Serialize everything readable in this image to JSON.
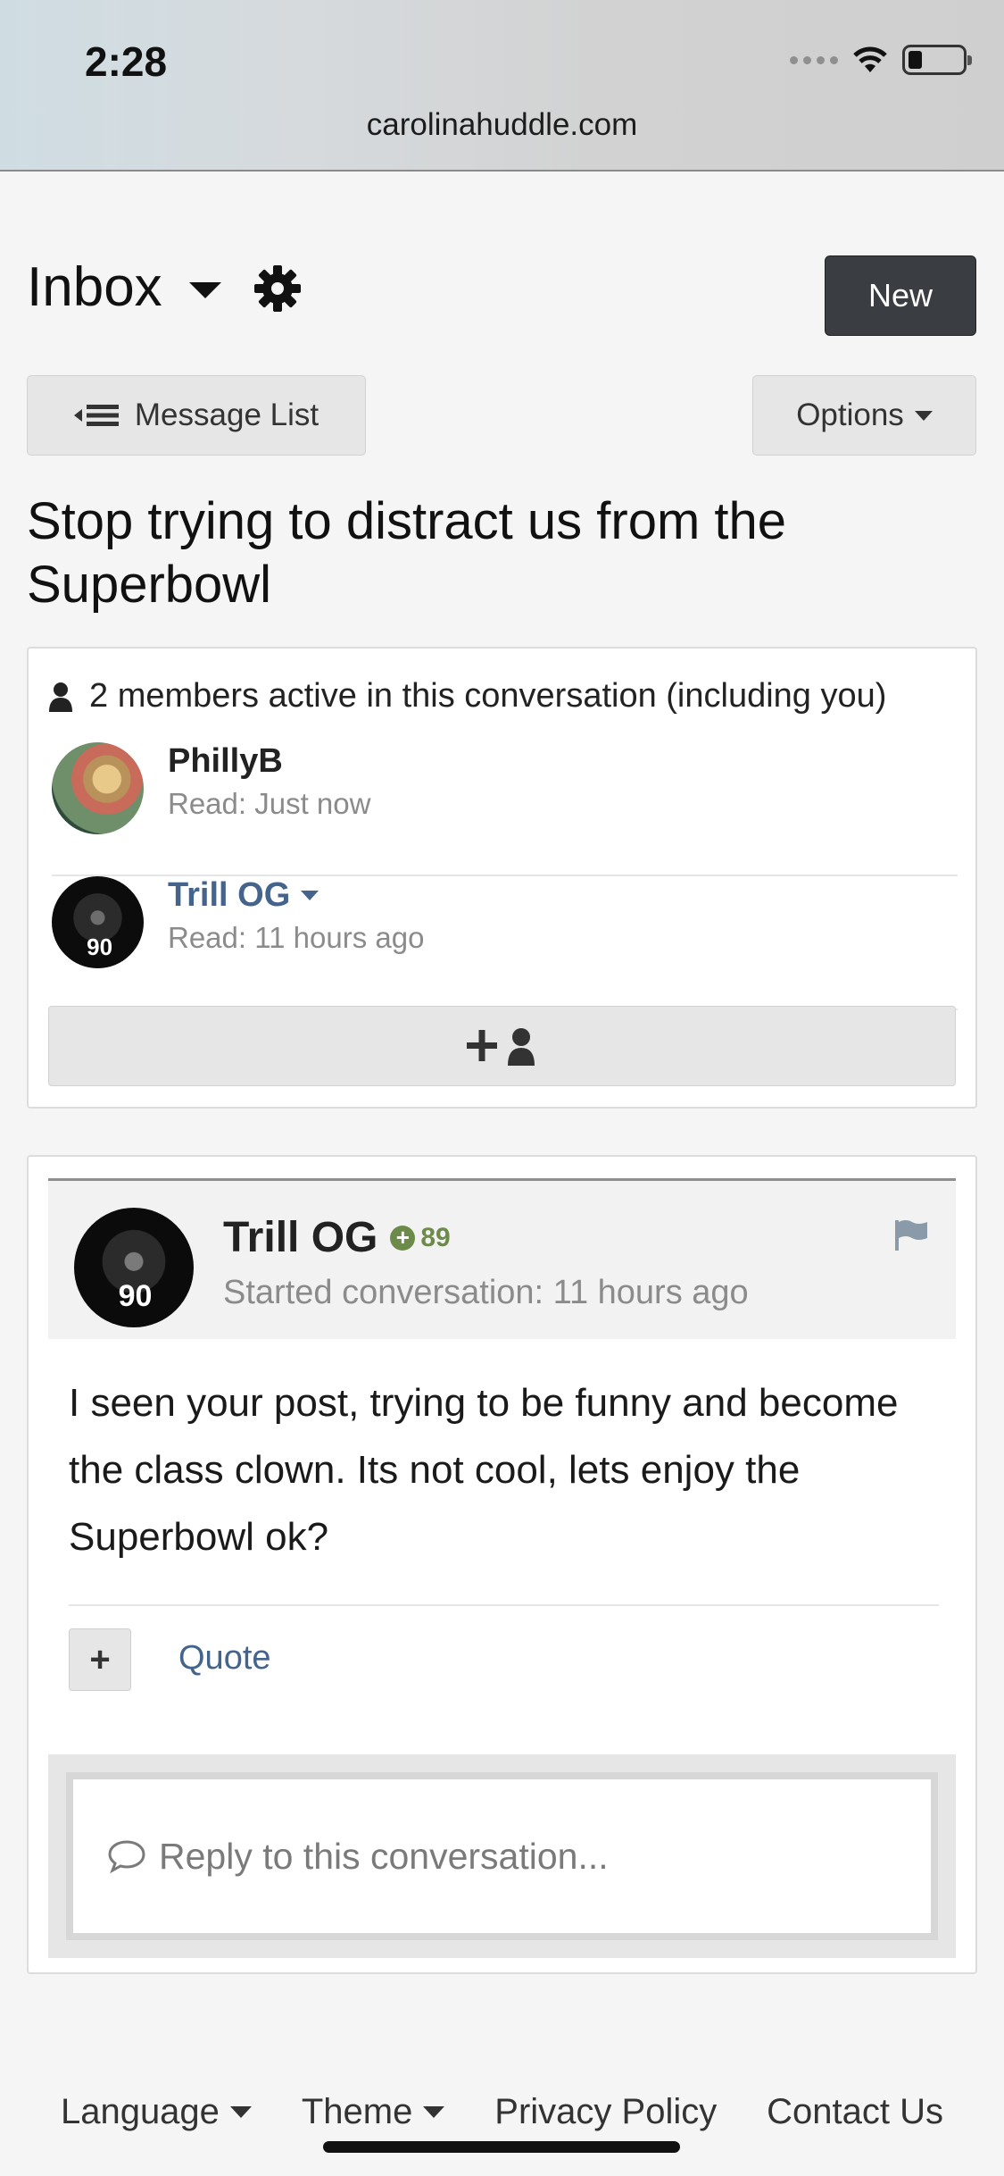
{
  "status_bar": {
    "time": "2:28"
  },
  "browser": {
    "url": "carolinahuddle.com"
  },
  "header": {
    "inbox_label": "Inbox",
    "new_label": "New"
  },
  "toolbar": {
    "message_list_label": "Message List",
    "options_label": "Options"
  },
  "conversation": {
    "title": "Stop trying to distract us from the Superbowl"
  },
  "participants": {
    "summary": "2 members active in this conversation (including you)",
    "members": [
      {
        "name": "PhillyB",
        "read": "Read: Just now"
      },
      {
        "name": "Trill OG",
        "read": "Read: 11 hours ago"
      }
    ]
  },
  "message": {
    "author": "Trill OG",
    "reputation": "89",
    "started": "Started conversation: 11 hours ago",
    "body": "I seen your post, trying to be funny and become the class clown. Its not cool, lets enjoy the Superbowl ok?",
    "plus_label": "+",
    "quote_label": "Quote",
    "avatar_jersey": "90"
  },
  "reply": {
    "placeholder": "Reply to this conversation..."
  },
  "footer": {
    "language": "Language",
    "theme": "Theme",
    "privacy": "Privacy Policy",
    "contact": "Contact Us"
  },
  "colors": {
    "link": "#44648c",
    "reputation": "#6c8a4a",
    "new_button": "#3a3d41"
  },
  "icons": [
    "gear-icon",
    "list-back-icon",
    "person-icon",
    "add-person-icon",
    "flag-icon",
    "comment-icon",
    "plus-circle-icon"
  ]
}
